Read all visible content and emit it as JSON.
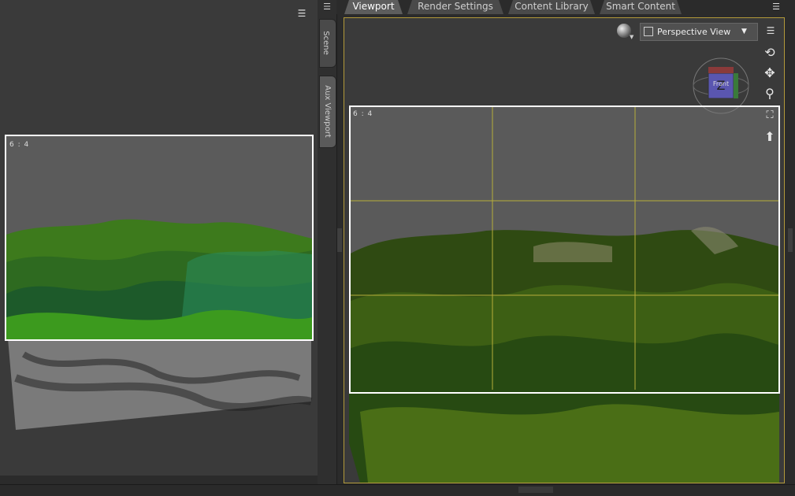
{
  "aux_viewport": {
    "ratio_label": "6 : 4",
    "menu_icon": "panel-menu-icon"
  },
  "side_tabs": [
    {
      "label": "Scene"
    },
    {
      "label": "Aux Viewport"
    }
  ],
  "top_tabs": [
    {
      "label": "Viewport",
      "active": true
    },
    {
      "label": "Render Settings",
      "active": false
    },
    {
      "label": "Content Library",
      "active": false
    },
    {
      "label": "Smart Content",
      "active": false
    }
  ],
  "viewport": {
    "ratio_label": "6 : 4",
    "view_select": "Perspective View",
    "cube_label": "Front",
    "cube_axis": "Z",
    "border_color": "#b39a3a",
    "tools": [
      "orbit-icon",
      "pan-icon",
      "zoom-icon",
      "frame-icon",
      "bend-icon"
    ]
  },
  "colors": {
    "terrain_green": "#4f8a22",
    "terrain_dark": "#1f3a12",
    "guide_yellow": "#b6ad3a"
  }
}
